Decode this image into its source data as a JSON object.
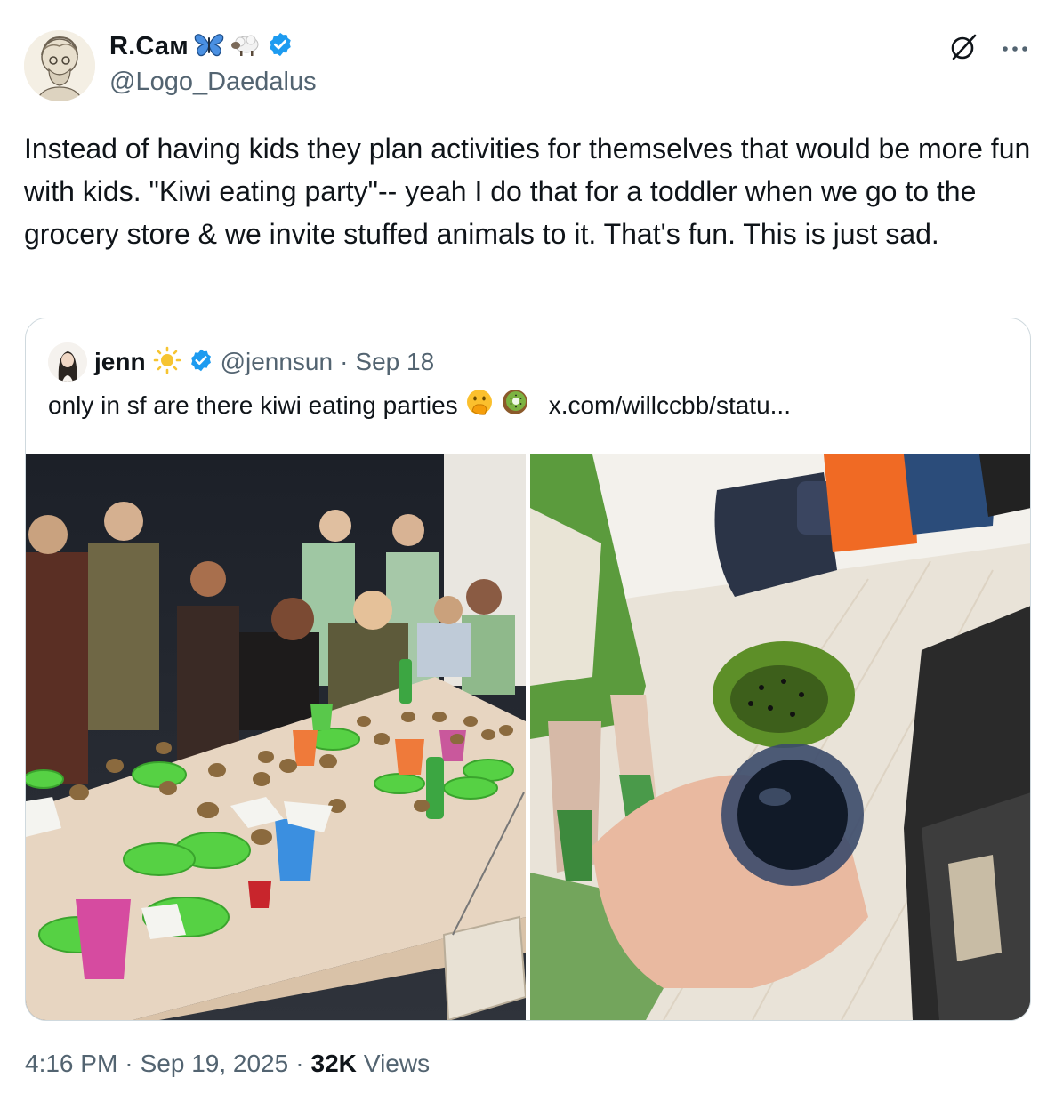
{
  "author": {
    "display_name": "R.Сам",
    "emoji": [
      "butterfly-icon",
      "sheep-icon"
    ],
    "handle": "@Logo_Daedalus",
    "verified": true,
    "avatar_icon": "sketch-portrait-avatar"
  },
  "top_actions": {
    "grok_icon": "grok-icon",
    "more_label": "···"
  },
  "tweet_text": "Instead of having kids they plan activities for themselves that would be more fun with kids. \"Kiwi eating party\"-- yeah I do that for a toddler when we go to the grocery store & we invite stuffed animals to it. That's fun. This is just sad.",
  "quote": {
    "display_name": "jenn",
    "emoji": "sun-icon",
    "verified": true,
    "handle": "@jennsun",
    "separator": "·",
    "date": "Sep 18",
    "text": "only in sf are there kiwi eating parties",
    "text_emoji": [
      "face-with-hand-over-mouth-icon",
      "kiwi-icon"
    ],
    "link": "x.com/willccbb/statu...",
    "photos": [
      "party-table-photo",
      "kiwi-in-hand-photo"
    ]
  },
  "footer": {
    "time": "4:16 PM",
    "sep1": "·",
    "date": "Sep 19, 2025",
    "sep2": "·",
    "views_count": "32K",
    "views_label": "Views"
  },
  "colors": {
    "verified_blue": "#1d9bf0",
    "text": "#0f1419",
    "secondary": "#536471",
    "border": "#cfd9de"
  }
}
